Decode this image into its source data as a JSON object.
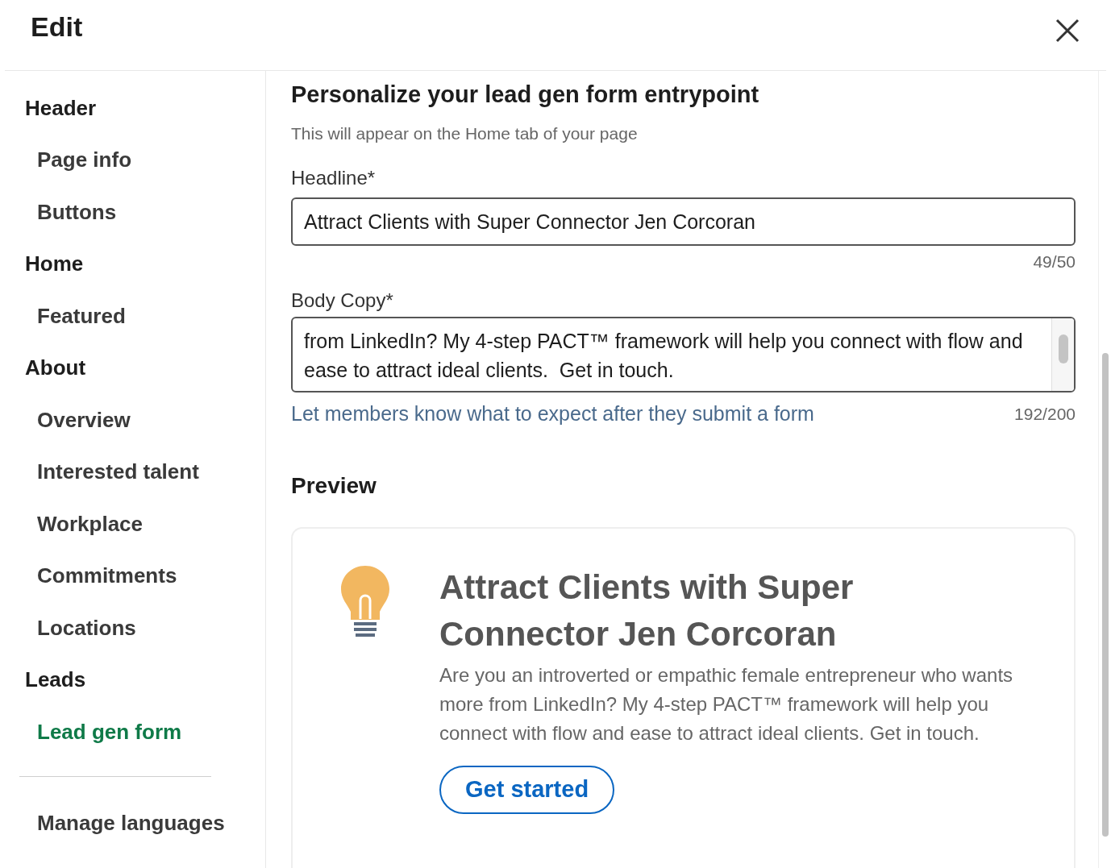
{
  "dialog": {
    "title": "Edit"
  },
  "sidebar": {
    "items": [
      {
        "label": "Header",
        "kind": "section",
        "selected": false
      },
      {
        "label": "Page info",
        "kind": "item",
        "selected": false
      },
      {
        "label": "Buttons",
        "kind": "item",
        "selected": false
      },
      {
        "label": "Home",
        "kind": "section",
        "selected": false
      },
      {
        "label": "Featured",
        "kind": "item",
        "selected": false
      },
      {
        "label": "About",
        "kind": "section",
        "selected": false
      },
      {
        "label": "Overview",
        "kind": "item",
        "selected": false
      },
      {
        "label": "Interested talent",
        "kind": "item",
        "selected": false
      },
      {
        "label": "Workplace",
        "kind": "item",
        "selected": false
      },
      {
        "label": "Commitments",
        "kind": "item",
        "selected": false
      },
      {
        "label": "Locations",
        "kind": "item",
        "selected": false
      },
      {
        "label": "Leads",
        "kind": "section",
        "selected": false
      },
      {
        "label": "Lead gen form",
        "kind": "item",
        "selected": true
      }
    ],
    "footer_item": "Manage languages"
  },
  "form": {
    "title": "Personalize your lead gen form entrypoint",
    "subtitle": "This will appear on the Home tab of your page",
    "headline": {
      "label": "Headline*",
      "value": "Attract Clients with Super Connector Jen Corcoran",
      "counter": "49/50"
    },
    "body_copy": {
      "label": "Body Copy*",
      "value": "from LinkedIn? My 4-step PACT™ framework will help you connect with flow and ease to attract ideal clients.  Get in touch.",
      "hint": "Let members know what to expect after they submit a form",
      "counter": "192/200"
    }
  },
  "preview": {
    "title": "Preview",
    "headline": "Attract Clients with Super Connector Jen Corcoran",
    "body": "Are you an introverted or empathic female entrepreneur who wants more from LinkedIn? My 4-step PACT™ framework will help you connect with flow and ease to attract ideal clients. Get in touch.",
    "button": "Get started"
  }
}
